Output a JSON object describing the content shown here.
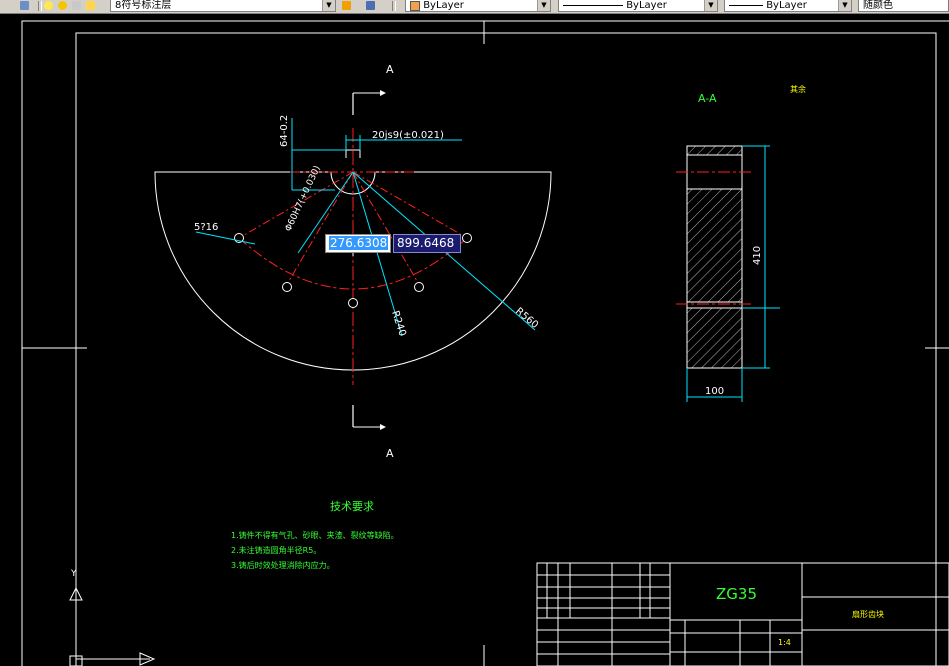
{
  "toolbar": {
    "layer_name": "8符号标注层",
    "color": "ByLayer",
    "linetype": "ByLayer",
    "lineweight": "ByLayer",
    "plotstyle": "随颜色"
  },
  "drawing": {
    "section_marker": "A",
    "section_title": "A-A",
    "roughness_note": "其余",
    "dim_keyway_depth": "64-0.2",
    "dim_keyway_width": "20js9(±0.021)",
    "dim_bore": "Φ60H7(+0.030)",
    "dim_holes": "5?16",
    "dim_r240": "R240",
    "dim_r560": "R560",
    "dim_height": "410",
    "dim_width": "100",
    "tech_title": "技术要求",
    "tech_notes": [
      "1.铸件不得有气孔、砂眼、夹渣、裂纹等缺陷。",
      "2.未注铸造圆角半径R5。",
      "3.铸后时效处理消除内应力。"
    ],
    "title_block": {
      "material": "ZG35",
      "part_name": "扇形齿块",
      "scale": "1:4"
    }
  },
  "input": {
    "x": "276.6308",
    "y": "899.6468"
  },
  "colors": {
    "line_white": "#ffffff",
    "center_red": "#ff2020",
    "dim_cyan": "#00e5ff",
    "text_green": "#33ff33",
    "text_yellow": "#ffff00"
  }
}
